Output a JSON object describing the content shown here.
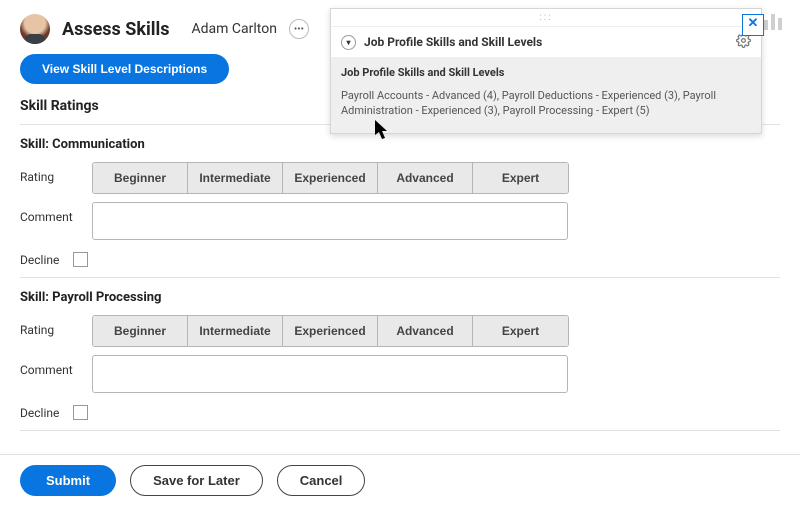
{
  "header": {
    "page_title": "Assess Skills",
    "user_name": "Adam Carlton"
  },
  "actions": {
    "view_descriptions": "View Skill Level Descriptions"
  },
  "section_heading": "Skill Ratings",
  "labels": {
    "rating": "Rating",
    "comment": "Comment",
    "decline": "Decline"
  },
  "rating_options": [
    "Beginner",
    "Intermediate",
    "Experienced",
    "Advanced",
    "Expert"
  ],
  "skills": [
    {
      "title": "Skill: Communication",
      "comment": ""
    },
    {
      "title": "Skill: Payroll Processing",
      "comment": ""
    }
  ],
  "footer": {
    "submit": "Submit",
    "save": "Save for Later",
    "cancel": "Cancel"
  },
  "popover": {
    "drag_handle": ":::",
    "close": "✕",
    "title": "Job Profile Skills and Skill Levels",
    "subhead": "Job Profile Skills and Skill Levels",
    "body": "Payroll Accounts - Advanced (4), Payroll Deductions - Experienced (3), Payroll Administration - Experienced (3), Payroll Processing - Expert (5)"
  }
}
